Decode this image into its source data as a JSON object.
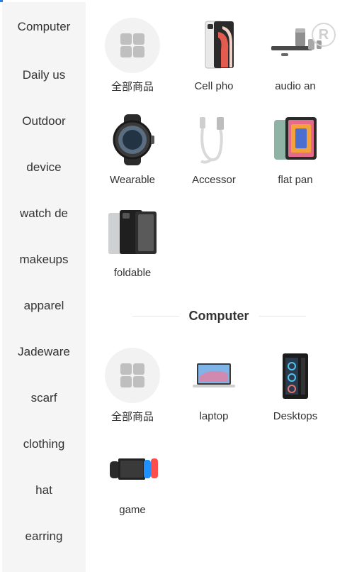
{
  "sidebar": {
    "items": [
      {
        "label": "Computer"
      },
      {
        "label": "Daily us"
      },
      {
        "label": "Outdoor"
      },
      {
        "label": "device"
      },
      {
        "label": "watch de"
      },
      {
        "label": "makeups"
      },
      {
        "label": "apparel"
      },
      {
        "label": "Jadeware"
      },
      {
        "label": "scarf"
      },
      {
        "label": "clothing"
      },
      {
        "label": "hat"
      },
      {
        "label": "earring"
      }
    ]
  },
  "group1": {
    "tiles": [
      {
        "label": "全部商品",
        "icon": "all-products-icon"
      },
      {
        "label": "Cell pho",
        "icon": "cell-phone-icon"
      },
      {
        "label": "audio an",
        "icon": "audio-icon"
      },
      {
        "label": "Wearable",
        "icon": "smartwatch-icon"
      },
      {
        "label": "Accessor",
        "icon": "usb-cable-icon"
      },
      {
        "label": "flat pan",
        "icon": "tablet-icon"
      },
      {
        "label": "foldable",
        "icon": "foldable-phone-icon"
      }
    ]
  },
  "section": {
    "title": "Computer"
  },
  "group2": {
    "tiles": [
      {
        "label": "全部商品",
        "icon": "all-products-icon"
      },
      {
        "label": "laptop",
        "icon": "laptop-icon"
      },
      {
        "label": "Desktops",
        "icon": "desktop-tower-icon"
      },
      {
        "label": "game",
        "icon": "game-console-icon"
      }
    ]
  },
  "watermark": {
    "text": "R"
  },
  "colors": {
    "sidebar_bg": "#f5f5f5",
    "accent": "#2f7ae5"
  }
}
